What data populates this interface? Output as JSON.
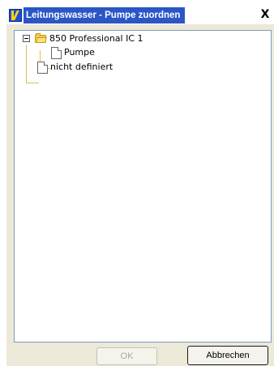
{
  "window": {
    "title": "Leitungswasser - Pumpe zuordnen",
    "close_label": "X"
  },
  "tree": {
    "items": [
      {
        "label": "850 Professional IC 1",
        "icon": "folder-icon",
        "expanded": true
      },
      {
        "label": "Pumpe",
        "icon": "document-icon"
      },
      {
        "label": "nicht definiert",
        "icon": "document-icon"
      }
    ]
  },
  "buttons": {
    "ok_label": "OK",
    "ok_enabled": false,
    "cancel_label": "Abbrechen"
  }
}
